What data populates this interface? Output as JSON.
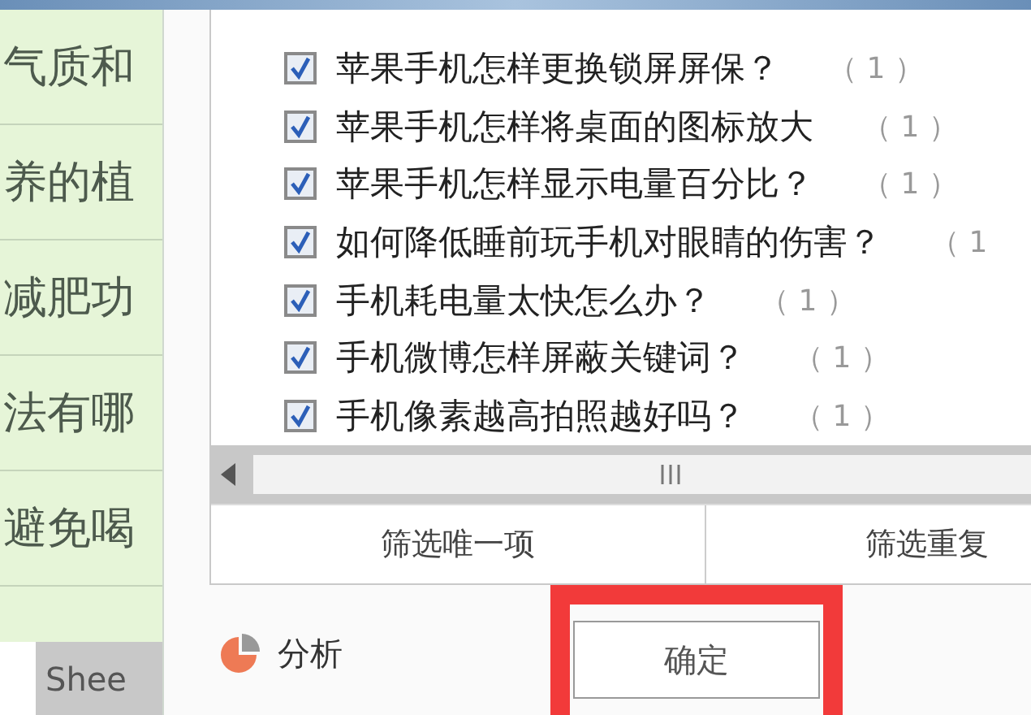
{
  "sheet": {
    "cells": [
      "气质和",
      "养的植",
      "减肥功",
      "法有哪",
      "避免喝"
    ],
    "tab": "Shee"
  },
  "filter_list": {
    "items": [
      {
        "label": "苹果手机怎样更换锁屏屏保？",
        "count": "（ 1 ）",
        "checked": true
      },
      {
        "label": "苹果手机怎样将桌面的图标放大",
        "count": "（ 1 ）",
        "checked": true
      },
      {
        "label": "苹果手机怎样显示电量百分比？",
        "count": "（ 1 ）",
        "checked": true
      },
      {
        "label": "如何降低睡前玩手机对眼睛的伤害？",
        "count": "（ 1",
        "checked": true
      },
      {
        "label": "手机耗电量太快怎么办？",
        "count": "（ 1 ）",
        "checked": true
      },
      {
        "label": "手机微博怎样屏蔽关键词？",
        "count": "（ 1 ）",
        "checked": true
      },
      {
        "label": "手机像素越高拍照越好吗？",
        "count": "（ 1 ）",
        "checked": true
      }
    ]
  },
  "filter_buttons": [
    "筛选唯一项",
    "筛选重复"
  ],
  "analysis_label": "分析",
  "ok_button": {
    "label": "确定",
    "highlighted": true
  }
}
